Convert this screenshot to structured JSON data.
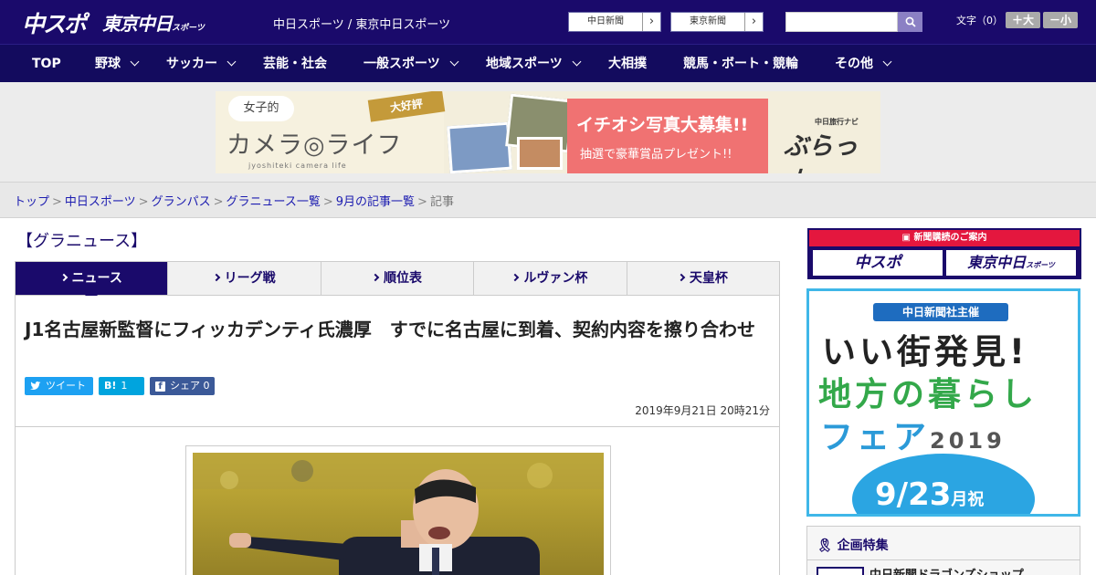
{
  "header": {
    "logo_chuspo": "中スポ",
    "logo_tokyo": "東京中日",
    "logo_tokyo_suffix": "スポーツ",
    "site_names": "中日スポーツ / 東京中日スポーツ",
    "paper_links": [
      "中日新聞",
      "東京新聞"
    ],
    "font_size_label": "文字（0）",
    "font_larger": "＋大",
    "font_smaller": "－小"
  },
  "nav": {
    "items": [
      {
        "label": "TOP"
      },
      {
        "label": "野球"
      },
      {
        "label": "サッカー"
      },
      {
        "label": "芸能・社会"
      },
      {
        "label": "一般スポーツ"
      },
      {
        "label": "地域スポーツ"
      },
      {
        "label": "大相撲"
      },
      {
        "label": "競馬・ボート・競輪"
      },
      {
        "label": "その他"
      }
    ]
  },
  "ad_banner": {
    "tag": "大好評",
    "joshi": "女子的",
    "camera": "カメラ◎ライフ",
    "sub": "jyoshiteki camera life",
    "main": "イチオシ写真大募集!!",
    "prize": "抽選で豪華賞品プレゼント!!",
    "navi_small": "中日旅行ナビ",
    "navi": "ぶらっ人",
    "colors": {
      "pink": "#f07272",
      "cream": "#f3eedc"
    }
  },
  "breadcrumb": {
    "items": [
      "トップ",
      "中日スポーツ",
      "グランパス",
      "グラニュース一覧",
      "9月の記事一覧"
    ],
    "current": "記事",
    "separator": ">"
  },
  "section_title": "【グラニュース】",
  "tabs": [
    {
      "label": "ニュース",
      "active": true
    },
    {
      "label": "リーグ戦",
      "active": false
    },
    {
      "label": "順位表",
      "active": false
    },
    {
      "label": "ルヴァン杯",
      "active": false
    },
    {
      "label": "天皇杯",
      "active": false
    }
  ],
  "article": {
    "headline": "J1名古屋新監督にフィッカデンティ氏濃厚　すでに名古屋に到着、契約内容を擦り合わせ",
    "share": {
      "tweet": "ツイート",
      "hatena_label": "B!",
      "hatena_count": "1",
      "facebook_label": "シェア",
      "facebook_count": "0"
    },
    "date": "2019年9月21日 20時21分"
  },
  "sidebar": {
    "subscribe_header": "新聞購読のご案内",
    "subscribe_buttons": [
      "中スポ",
      "東京中日"
    ],
    "subscribe_suffix": "スポーツ",
    "fair": {
      "sponsor": "中日新聞社主催",
      "line1": "いい街発見!",
      "line2": "地方の暮らし",
      "line3": "フェア",
      "year": "2019",
      "date": "9/23",
      "date_suffix": "月祝"
    },
    "feature_title": "企画特集",
    "feature_item": "中日新聞ドラゴンズショップ"
  },
  "colors": {
    "brand": "#1a0a6b",
    "link": "#1c1cb0",
    "twitter": "#1da1f2",
    "hatena": "#00a4de",
    "facebook": "#3b5998",
    "subscribe_red": "#e4173e",
    "fair_border": "#3fb7e8"
  }
}
